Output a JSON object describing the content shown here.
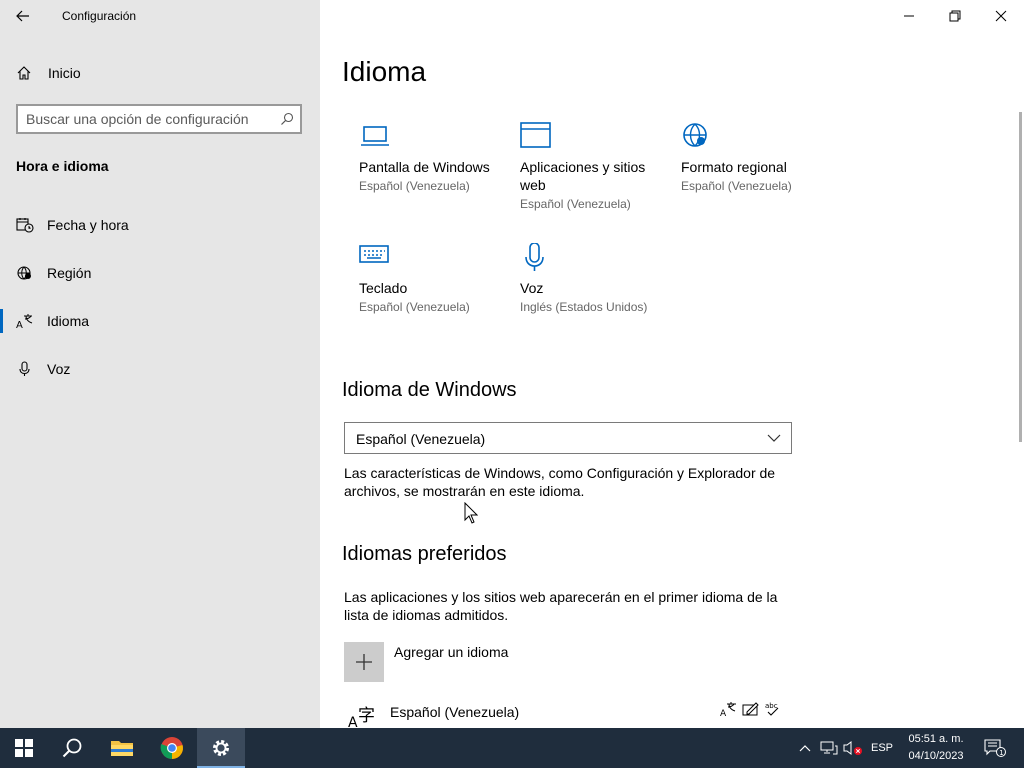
{
  "window": {
    "title": "Configuración",
    "controls": [
      "minimize",
      "restore",
      "close"
    ]
  },
  "sidebar": {
    "home_label": "Inicio",
    "search_placeholder": "Buscar una opción de configuración",
    "section_title": "Hora e idioma",
    "items": [
      {
        "label": "Fecha y hora",
        "icon": "calendar-clock-icon",
        "active": false
      },
      {
        "label": "Región",
        "icon": "globe-region-icon",
        "active": false
      },
      {
        "label": "Idioma",
        "icon": "language-icon",
        "active": true
      },
      {
        "label": "Voz",
        "icon": "microphone-icon",
        "active": false
      }
    ]
  },
  "main": {
    "title": "Idioma",
    "tiles": [
      {
        "name": "Pantalla de Windows",
        "sub": "Español (Venezuela)",
        "icon": "laptop-icon"
      },
      {
        "name": "Aplicaciones y sitios web",
        "sub": "Español (Venezuela)",
        "icon": "window-icon"
      },
      {
        "name": "Formato regional",
        "sub": "Español (Venezuela)",
        "icon": "globe-settings-icon"
      },
      {
        "name": "Teclado",
        "sub": "Español (Venezuela)",
        "icon": "keyboard-icon"
      },
      {
        "name": "Voz",
        "sub": "Inglés (Estados Unidos)",
        "icon": "microphone-icon"
      }
    ],
    "windows_language": {
      "heading": "Idioma de Windows",
      "selected": "Español (Venezuela)",
      "description": "Las características de Windows, como Configuración y Explorador de archivos, se mostrarán en este idioma."
    },
    "preferred": {
      "heading": "Idiomas preferidos",
      "description": "Las aplicaciones y los sitios web aparecerán en el primer idioma de la lista de idiomas admitidos.",
      "add_label": "Agregar un idioma",
      "languages": [
        {
          "name": "Español (Venezuela)",
          "features": [
            "display-language-icon",
            "handwriting-icon",
            "spellcheck-icon"
          ]
        }
      ]
    }
  },
  "taskbar": {
    "apps": [
      "start-icon",
      "search-icon",
      "file-explorer-icon",
      "chrome-icon",
      "settings-icon"
    ],
    "language": "ESP",
    "time": "05:51 a. m.",
    "date": "04/10/2023",
    "notification_count": "1"
  },
  "colors": {
    "accent": "#0067c0",
    "sidebar_bg": "#e6e6e6",
    "taskbar_bg": "#1f2d3d"
  }
}
